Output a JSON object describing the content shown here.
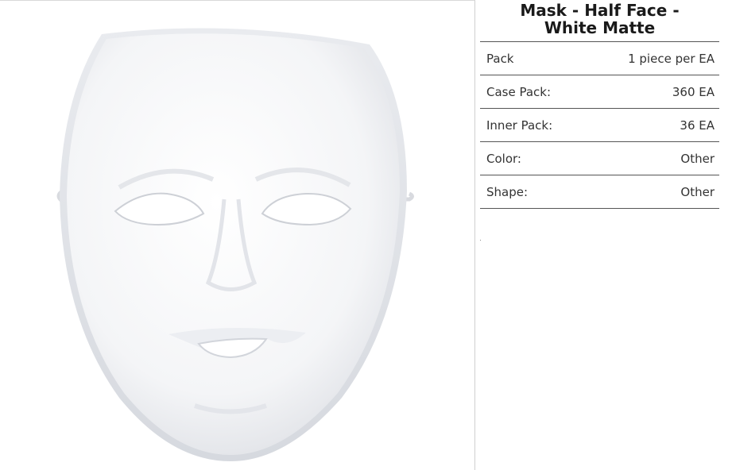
{
  "product": {
    "title_line1": "Mask - Half Face -",
    "title_line2": "White Matte",
    "image_alt": "white matte face mask"
  },
  "specs": [
    {
      "label": "Pack",
      "value": "1 piece per EA"
    },
    {
      "label": "Case Pack:",
      "value": "360 EA"
    },
    {
      "label": "Inner Pack:",
      "value": "36 EA"
    },
    {
      "label": "Color:",
      "value": "Other"
    },
    {
      "label": "Shape:",
      "value": "Other"
    }
  ]
}
